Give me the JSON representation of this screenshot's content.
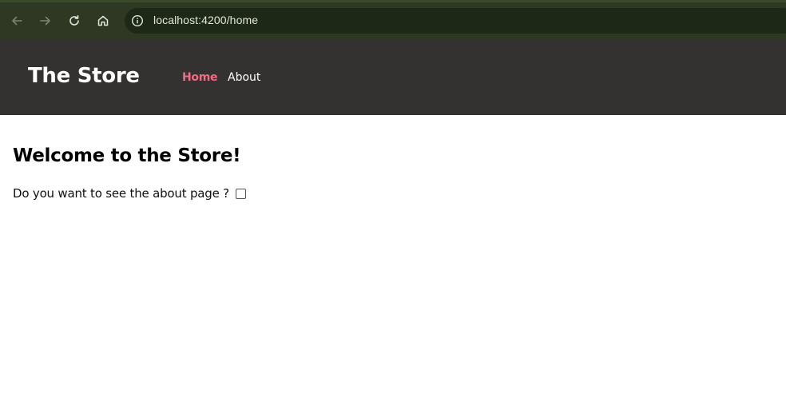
{
  "browser": {
    "back_icon": "arrow-left-icon",
    "forward_icon": "arrow-right-icon",
    "reload_icon": "reload-icon",
    "home_icon": "home-icon",
    "site_info_icon": "info-icon",
    "url": "localhost:4200/home",
    "colors": {
      "toolbar": "#2f3823",
      "address_bar": "#1e2816"
    }
  },
  "header": {
    "brand": "The Store",
    "nav": [
      {
        "label": "Home",
        "active": true
      },
      {
        "label": "About",
        "active": false
      }
    ],
    "colors": {
      "background": "#333231",
      "active_link": "#ef6b86",
      "link": "#ffffff"
    }
  },
  "main": {
    "title": "Welcome to the Store!",
    "question": "Do you want to see the about page ?",
    "checkbox_checked": false
  }
}
